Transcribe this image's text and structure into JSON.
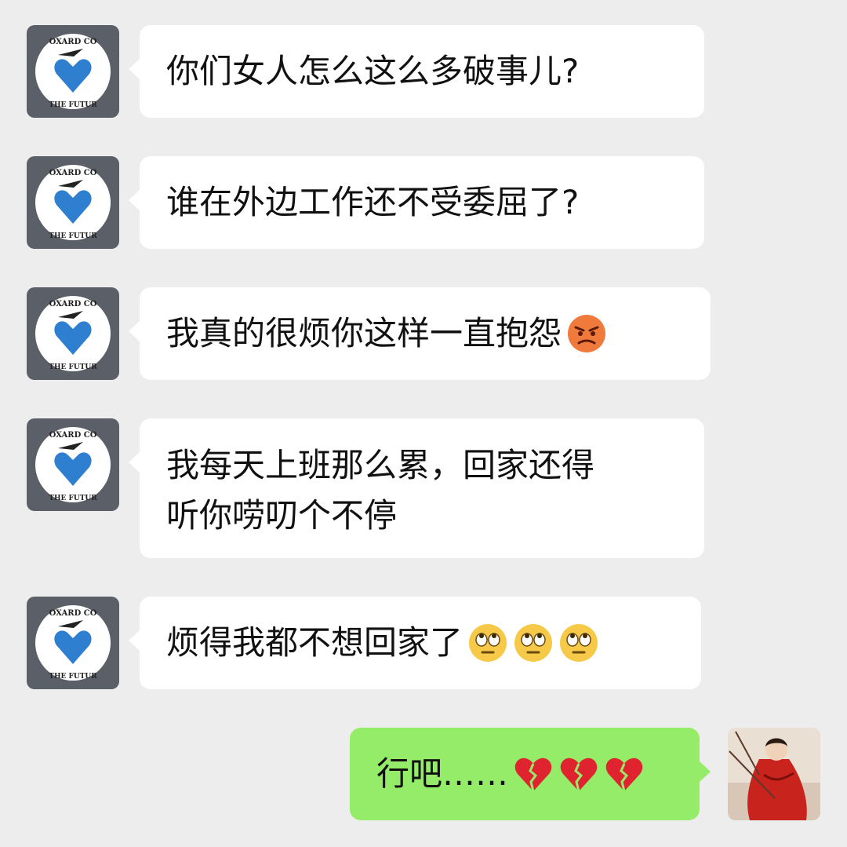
{
  "messages": [
    {
      "from": "other",
      "text": "你们女人怎么这么多破事儿?",
      "emojis": []
    },
    {
      "from": "other",
      "text": "谁在外边工作还不受委屈了?",
      "emojis": []
    },
    {
      "from": "other",
      "text": "我真的很烦你这样一直抱怨",
      "emojis": [
        "angry-face"
      ]
    },
    {
      "from": "other",
      "text": "我每天上班那么累，回家还得\n听你唠叨个不停",
      "emojis": []
    },
    {
      "from": "other",
      "text": "烦得我都不想回家了",
      "emojis": [
        "eye-roll-face",
        "eye-roll-face",
        "eye-roll-face"
      ]
    },
    {
      "from": "me",
      "text": "行吧……",
      "emojis": [
        "broken-heart",
        "broken-heart",
        "broken-heart"
      ]
    }
  ],
  "avatars": {
    "other": {
      "icon": "blue-heart-emblem-icon",
      "emblem_text_top": "OXARD CO",
      "emblem_text_bottom": "THE FUTUR"
    },
    "me": {
      "icon": "photo-red-dress-avatar"
    }
  },
  "colors": {
    "background": "#ededed",
    "incoming_bubble": "#ffffff",
    "outgoing_bubble": "#95ec69",
    "emblem_blue": "#2f7fd0"
  }
}
